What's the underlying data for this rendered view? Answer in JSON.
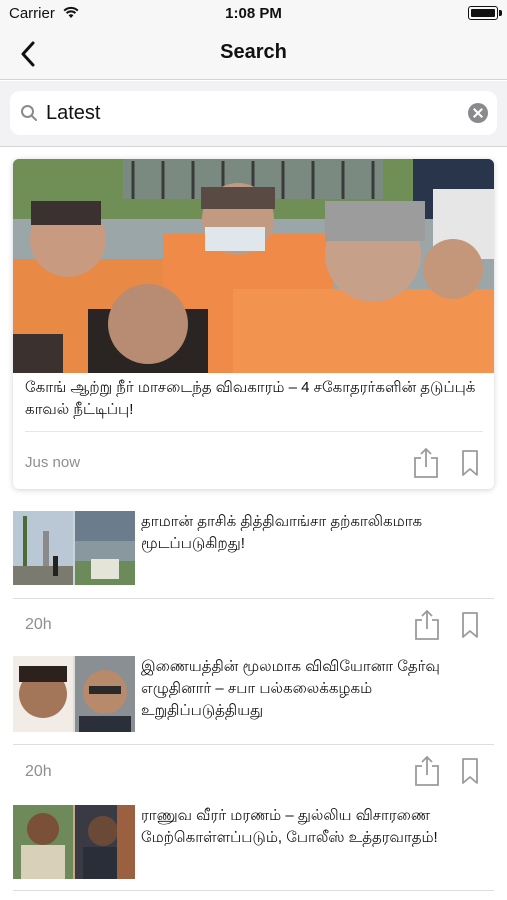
{
  "status_bar": {
    "carrier": "Carrier",
    "time": "1:08 PM"
  },
  "nav": {
    "title": "Search"
  },
  "search": {
    "query": "Latest"
  },
  "featured": {
    "title": "கோங் ஆற்று நீர் மாசடைந்த விவகாரம் – 4 சகோதரர்களின் தடுப்புக் காவல் நீட்டிப்பு!",
    "time": "Jus now"
  },
  "articles": [
    {
      "title": "தாமான் தாசிக் தித்திவாங்சா தற்காலிகமாக மூடப்படுகிறது!",
      "time": "20h"
    },
    {
      "title": "இணையத்தின் மூலமாக விவியோனா தேர்வு எழுதினார் – சபா பல்கலைக்கழகம் உறுதிப்படுத்தியது",
      "time": "20h"
    },
    {
      "title": "ராணுவ வீரர் மரணம் – துல்லிய விசாரணை மேற்கொள்ளப்படும், போலீஸ் உத்தரவாதம்!"
    }
  ],
  "colors": {
    "bar_bg": "#f7f7f7",
    "search_bg": "#f2f2f4",
    "meta_text": "#8e8e93",
    "icon_gray": "#9b9b9b"
  }
}
